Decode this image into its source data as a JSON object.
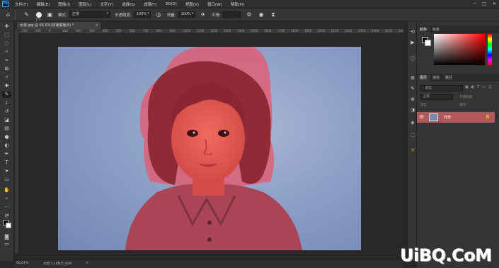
{
  "app": {
    "logo": "Ps"
  },
  "menu": [
    "文件(F)",
    "编辑(E)",
    "图像(I)",
    "图层(L)",
    "文字(Y)",
    "选择(S)",
    "滤镜(T)",
    "3D(D)",
    "视图(V)",
    "窗口(W)",
    "帮助(H)"
  ],
  "window_controls": {
    "minimize": "─",
    "maximize": "□",
    "close": "✕"
  },
  "options": {
    "brush_size": "175",
    "mode_label": "模式:",
    "mode_value": "正常",
    "opacity_label": "不透明度:",
    "opacity_value": "100%",
    "flow_label": "流量:",
    "flow_value": "100%",
    "smooth_label": "平滑:"
  },
  "document": {
    "tab_title": "女孩.jpg @ 66.6%(快速蒙版/8) *",
    "close": "×"
  },
  "ruler": {
    "ticks": [
      "200",
      "100",
      "0",
      "100",
      "200",
      "300",
      "400",
      "500",
      "600",
      "700",
      "800",
      "900",
      "1000",
      "1100",
      "1200",
      "1300",
      "1400",
      "1500",
      "1600",
      "1700",
      "1800",
      "1900",
      "2000",
      "2100",
      "2200",
      "2300",
      "2400",
      "2500",
      "2600"
    ]
  },
  "status": {
    "zoom": "66.61%",
    "doc": "文档:7.10M/5.46M",
    "arrow": ">"
  },
  "panels": {
    "color_tabs": [
      "颜色",
      "色板"
    ],
    "layer_tabs": [
      "图层",
      "通道",
      "路径"
    ],
    "search_placeholder": "类型",
    "blend_mode": "正常",
    "opacity_label": "不透明度:",
    "lock_label": "锁定:",
    "fill_label": "填充:",
    "layer_name": "背景"
  },
  "watermark": "UiBQ.CoM",
  "colors": {
    "mask_overlay": "#ff4b4b",
    "background_blue": "#8ea0c6",
    "layer_selected": "#b3585c",
    "accent_orange": "#e09b24"
  },
  "icons": {
    "tools": [
      "move-icon",
      "marquee-icon",
      "lasso-icon",
      "magic-wand-icon",
      "crop-icon",
      "frame-icon",
      "eyedropper-icon",
      "healing-icon",
      "brush-icon",
      "stamp-icon",
      "history-brush-icon",
      "eraser-icon",
      "gradient-icon",
      "blur-icon",
      "dodge-icon",
      "pen-icon",
      "type-icon",
      "path-select-icon",
      "shape-icon",
      "hand-icon",
      "zoom-icon",
      "more-icon",
      "swap-icon",
      "quick-mask-icon",
      "screen-mode-icon"
    ],
    "side": [
      "history-icon",
      "play-icon",
      "info-icon",
      "properties-icon",
      "brush-settings-icon",
      "clone-source-icon",
      "adjustments-icon",
      "3d-icon",
      "tools-orange-icon"
    ]
  }
}
